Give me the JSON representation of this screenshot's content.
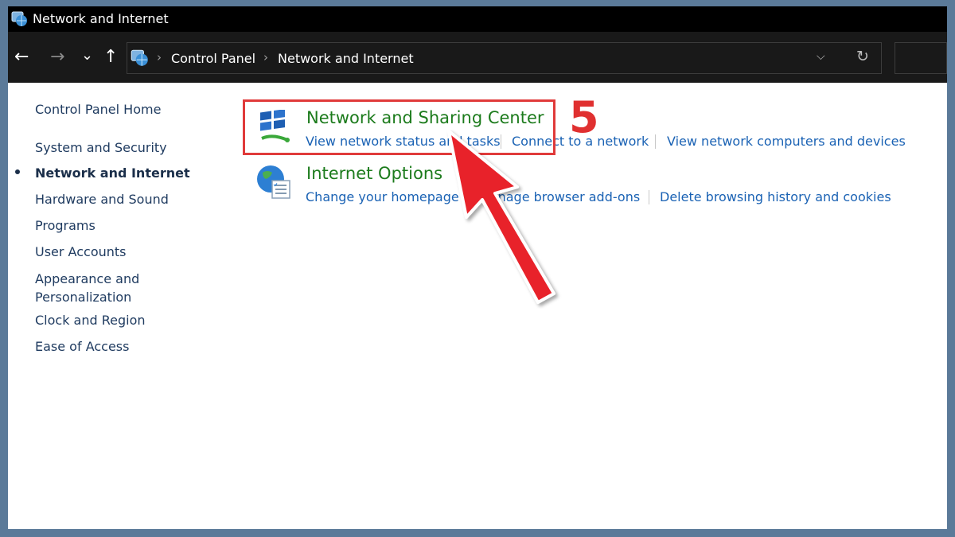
{
  "window": {
    "title": "Network and Internet"
  },
  "nav": {
    "back_icon": "←",
    "forward_icon": "→",
    "recent_icon": "⌄",
    "up_icon": "↑",
    "dropdown_icon": "⌵",
    "refresh_icon": "↻"
  },
  "breadcrumb": {
    "items": [
      "Control Panel",
      "Network and Internet"
    ],
    "separator": "›"
  },
  "sidebar": {
    "items": [
      {
        "label": "Control Panel Home"
      },
      {
        "label": "System and Security"
      },
      {
        "label": "Network and Internet",
        "current": true
      },
      {
        "label": "Hardware and Sound"
      },
      {
        "label": "Programs"
      },
      {
        "label": "User Accounts"
      },
      {
        "label": "Appearance and Personalization",
        "lines": [
          "Appearance and",
          "Personalization"
        ]
      },
      {
        "label": "Clock and Region"
      },
      {
        "label": "Ease of Access"
      }
    ]
  },
  "categories": [
    {
      "title": "Network and Sharing Center",
      "icon": "network-sharing-icon",
      "links": [
        "View network status and tasks",
        "Connect to a network",
        "View network computers and devices"
      ]
    },
    {
      "title": "Internet Options",
      "icon": "internet-options-icon",
      "links": [
        "Change your homepage",
        "Manage browser add-ons",
        "Delete browsing history and cookies"
      ]
    }
  ],
  "annotation": {
    "step": "5",
    "color": "#e03030"
  },
  "colors": {
    "titlebar": "#000000",
    "navbar": "#191919",
    "category_title": "#1c7b1c",
    "link": "#1a62b4",
    "frame": "#5b7a99"
  }
}
